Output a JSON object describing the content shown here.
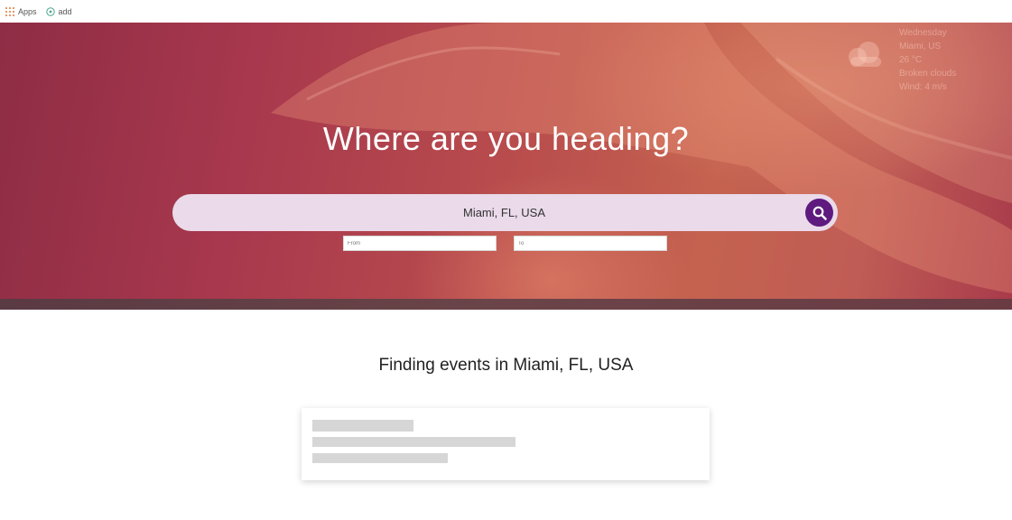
{
  "bookmarks": [
    {
      "label": "Apps",
      "icon": "apps-grid-icon"
    },
    {
      "label": "add",
      "icon": "add-circle-icon"
    }
  ],
  "hero": {
    "title": "Where are you heading?",
    "weather": {
      "icon": "cloud-icon",
      "lines": [
        "Wednesday",
        "Miami, US",
        "26 °C",
        "Broken clouds",
        "Wind: 4 m/s"
      ]
    },
    "search": {
      "value": "Miami, FL, USA",
      "button_icon": "search-icon"
    },
    "date_from": {
      "placeholder": "From"
    },
    "date_to": {
      "placeholder": "To"
    }
  },
  "results": {
    "heading": "Finding events in Miami, FL, USA"
  },
  "colors": {
    "search_button": "#5e1a7e",
    "search_bar_bg": "#eadaea",
    "hero_primary": "#a8384d"
  }
}
